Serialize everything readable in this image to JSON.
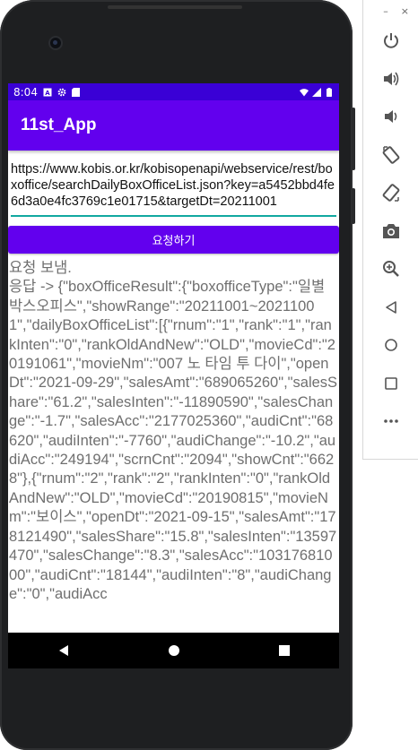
{
  "status_bar": {
    "time": "8:04"
  },
  "app_bar": {
    "title": "11st_App"
  },
  "url_input": {
    "value": "https://www.kobis.or.kr/kobisopenapi/webservice/rest/boxoffice/searchDailyBoxOfficeList.json?key=a5452bbd4fe6d3a0e4fc3769c1e01715&targetDt=20211001"
  },
  "request_button": {
    "label": "요청하기"
  },
  "output": {
    "line1": "요청 보냄.",
    "line2": "응답 -> {\"boxOfficeResult\":{\"boxofficeType\":\"일별 박스오피스\",\"showRange\":\"20211001~20211001\",\"dailyBoxOfficeList\":[{\"rnum\":\"1\",\"rank\":\"1\",\"rankInten\":\"0\",\"rankOldAndNew\":\"OLD\",\"movieCd\":\"20191061\",\"movieNm\":\"007 노 타임 투 다이\",\"openDt\":\"2021-09-29\",\"salesAmt\":\"689065260\",\"salesShare\":\"61.2\",\"salesInten\":\"-11890590\",\"salesChange\":\"-1.7\",\"salesAcc\":\"2177025360\",\"audiCnt\":\"68620\",\"audiInten\":\"-7760\",\"audiChange\":\"-10.2\",\"audiAcc\":\"249194\",\"scrnCnt\":\"2094\",\"showCnt\":\"6628\"},{\"rnum\":\"2\",\"rank\":\"2\",\"rankInten\":\"0\",\"rankOldAndNew\":\"OLD\",\"movieCd\":\"20190815\",\"movieNm\":\"보이스\",\"openDt\":\"2021-09-15\",\"salesAmt\":\"178121490\",\"salesShare\":\"15.8\",\"salesInten\":\"13597470\",\"salesChange\":\"8.3\",\"salesAcc\":\"10317681000\",\"audiCnt\":\"18144\",\"audiInten\":\"8\",\"audiChange\":\"0\",\"audiAcc"
  },
  "toolbar": {
    "minimize": "–",
    "close": "×"
  },
  "icons": {
    "toolbar": [
      "power-icon",
      "volume-up-icon",
      "volume-down-icon",
      "rotate-left-icon",
      "rotate-right-icon",
      "camera-icon",
      "zoom-icon",
      "back-icon",
      "home-icon",
      "overview-icon",
      "more-icon"
    ]
  },
  "colors": {
    "status_bar": "#3a00d6",
    "app_bar": "#6200ee",
    "accent_underline": "#12a8a0",
    "button": "#6200ee",
    "output_text": "#6f6f6f"
  }
}
